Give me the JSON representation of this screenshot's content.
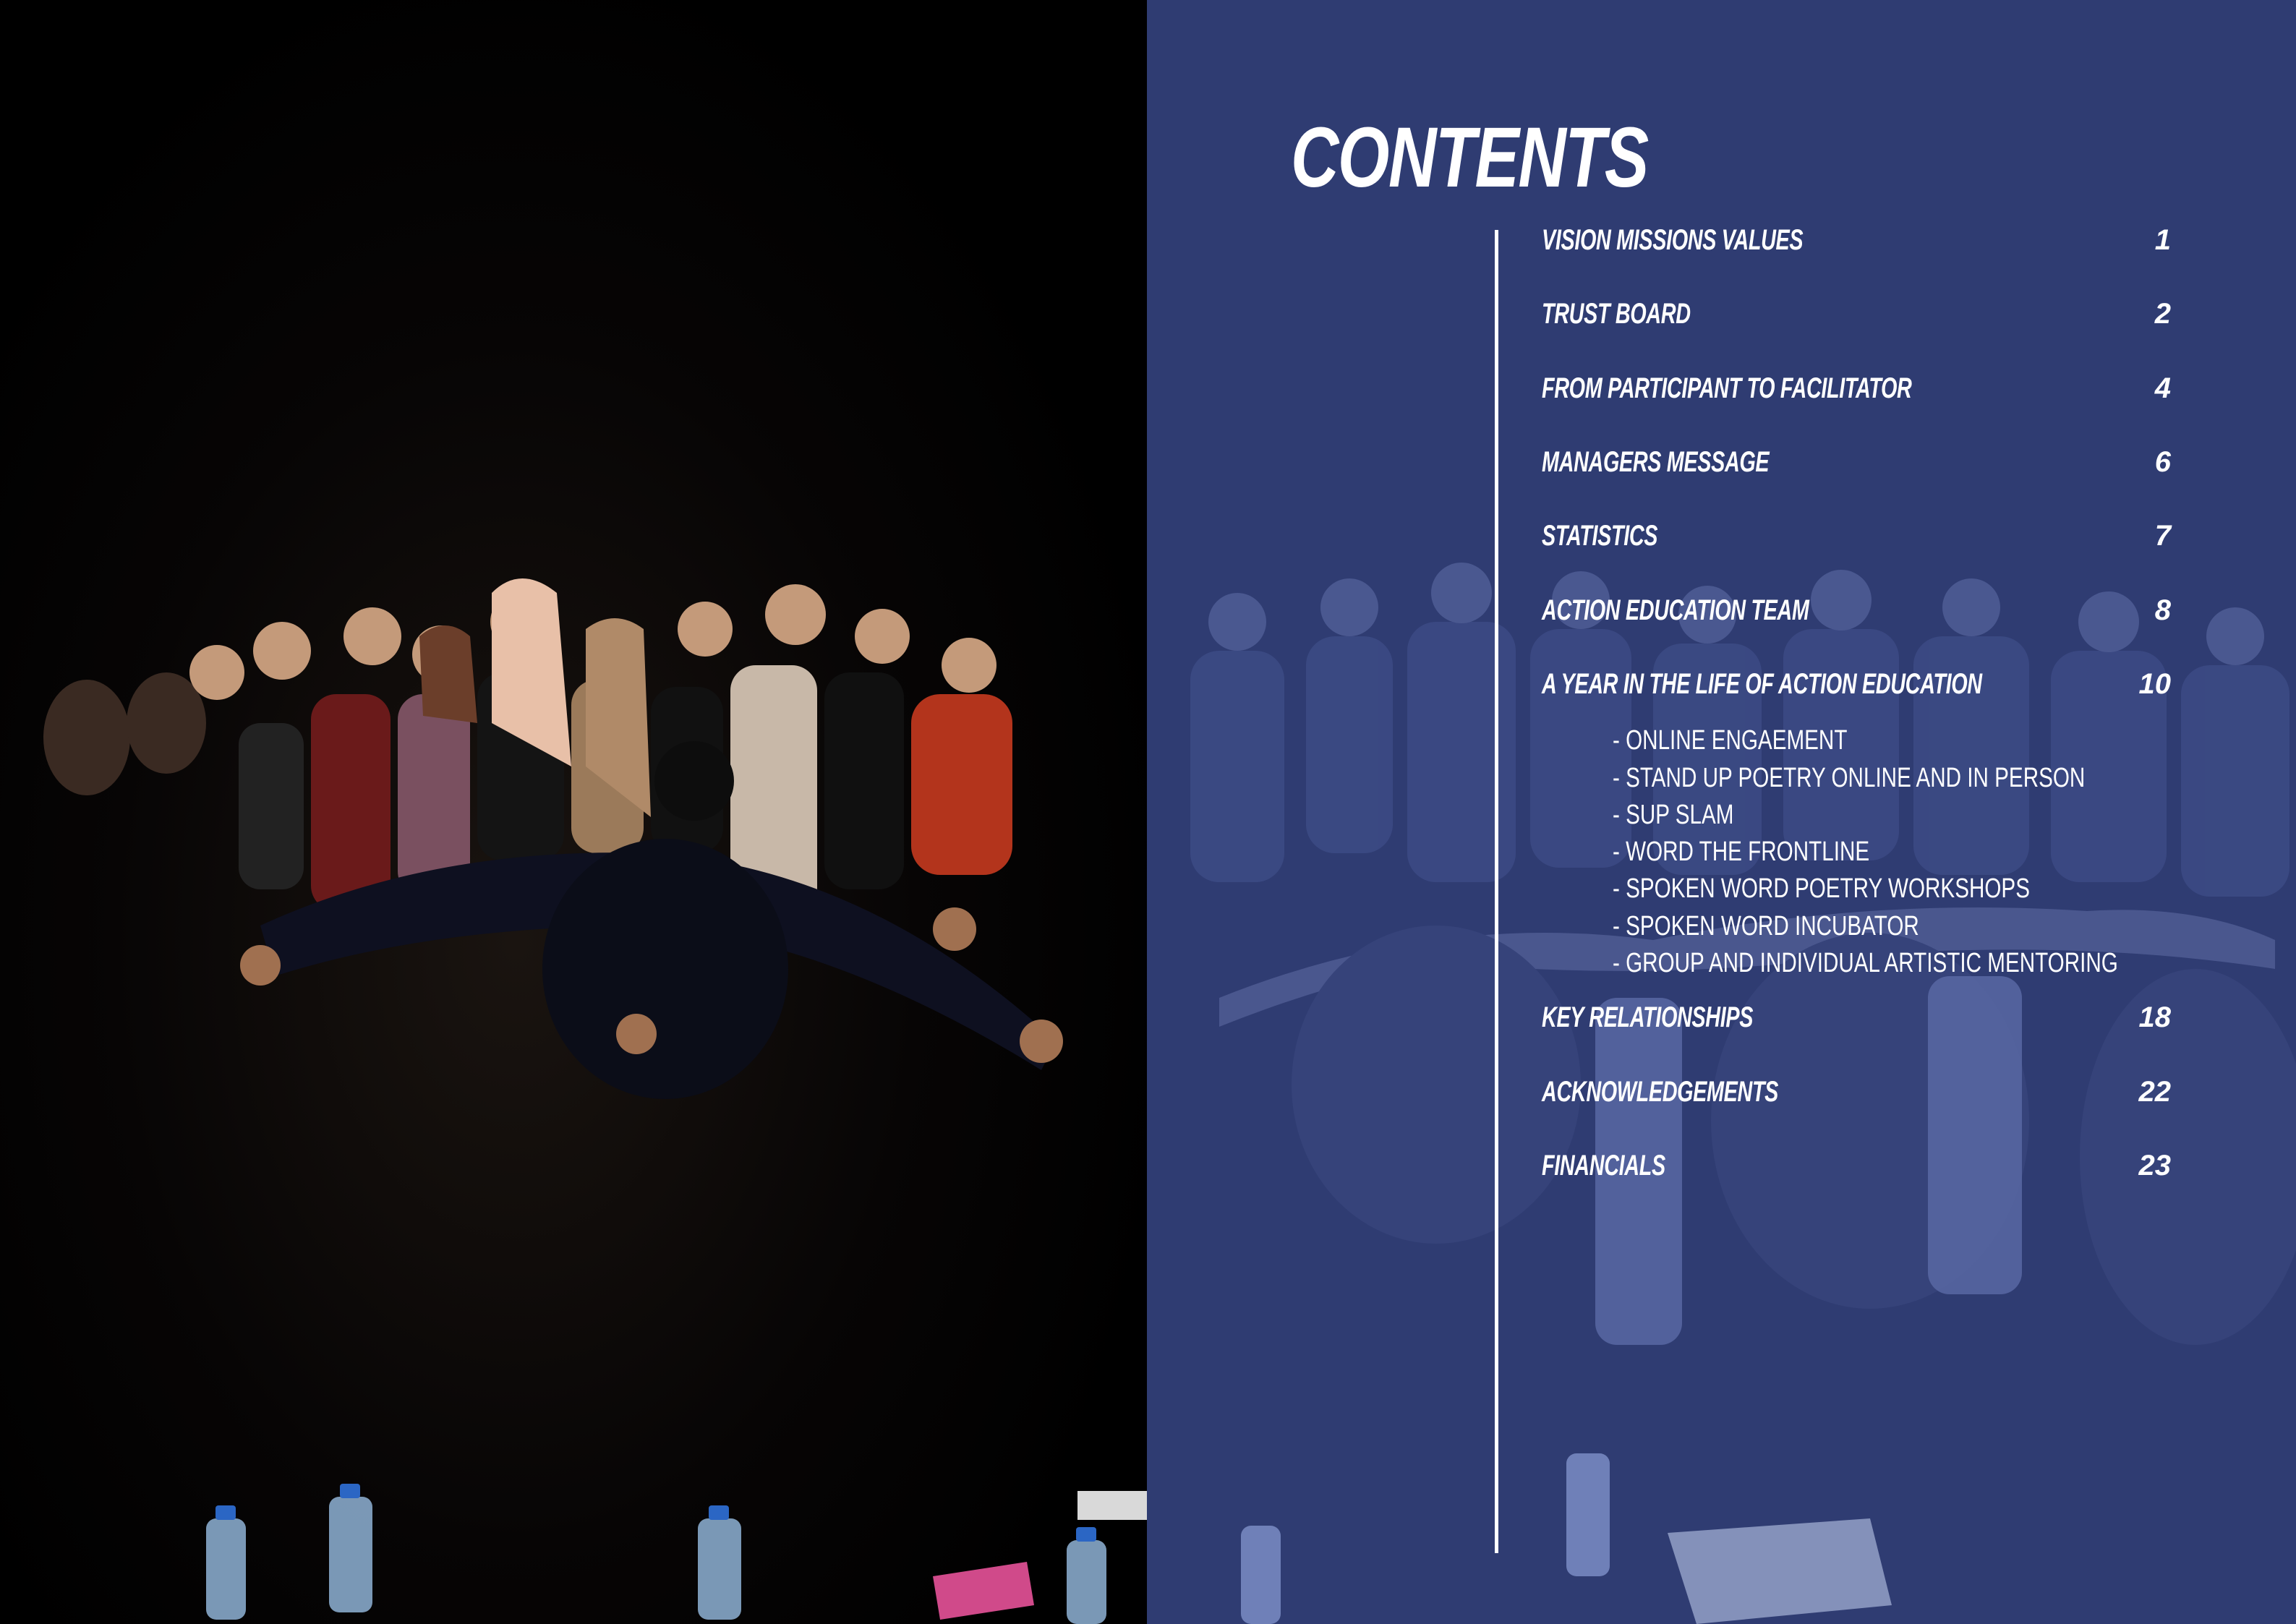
{
  "page": {
    "title": "CONTENTS",
    "accent_color": "#2f3c72",
    "text_color": "#ffffff"
  },
  "photo": {
    "description_icon": "group-circle-photo"
  },
  "toc": {
    "items": [
      {
        "label": "VISION   MISSIONS   VALUES",
        "page": "1"
      },
      {
        "label": "TRUST BOARD",
        "page": "2"
      },
      {
        "label": "FROM PARTICIPANT TO FACILITATOR",
        "page": "4"
      },
      {
        "label": "MANAGERS MESSAGE",
        "page": "6"
      },
      {
        "label": "STATISTICS",
        "page": "7"
      },
      {
        "label": "ACTION EDUCATION TEAM",
        "page": "8"
      },
      {
        "label": "A YEAR IN THE LIFE OF ACTION EDUCATION",
        "page": "10"
      },
      {
        "label": "KEY RELATIONSHIPS",
        "page": "18"
      },
      {
        "label": "ACKNOWLEDGEMENTS",
        "page": "22"
      },
      {
        "label": "FINANCIALS",
        "page": "23"
      }
    ],
    "subitems": [
      "- ONLINE ENGAEMENT",
      "- STAND UP POETRY ONLINE AND IN PERSON",
      "- SUP SLAM",
      "- WORD THE FRONTLINE",
      "- SPOKEN WORD POETRY WORKSHOPS",
      "- SPOKEN WORD INCUBATOR",
      "- GROUP AND INDIVIDUAL ARTISTIC MENTORING"
    ]
  }
}
